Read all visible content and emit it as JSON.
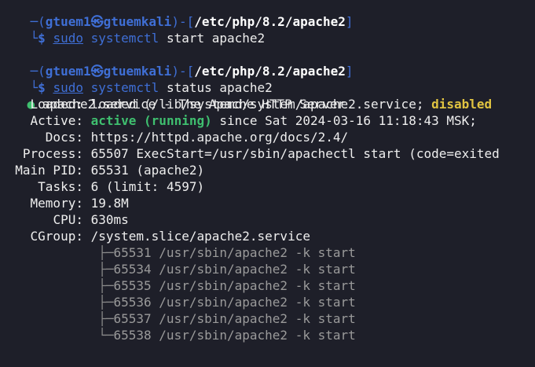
{
  "colors": {
    "background": "#1e1f29",
    "prompt_frame": "#3f6fd6",
    "active_green": "#3fbf6f",
    "disabled_yellow": "#e0c341",
    "faded_text": "#9a9a9a"
  },
  "prompt1": {
    "frame_left": "─(",
    "user": "gtuem1",
    "at_symbol": "㉿",
    "host": "gtuemkali",
    "frame_mid": ")-[",
    "path": "/etc/php/8.2/apache2",
    "frame_right": "]",
    "dollar": "└$",
    "sudo": "sudo",
    "command": "systemctl",
    "args": "start apache2"
  },
  "prompt2": {
    "frame_left": "─(",
    "user": "gtuem1",
    "at_symbol": "㉿",
    "host": "gtuemkali",
    "frame_mid": ")-[",
    "path": "/etc/php/8.2/apache2",
    "frame_right": "]",
    "dollar": "└$",
    "sudo": "sudo",
    "command": "systemctl",
    "args": "status apache2"
  },
  "status": {
    "dot": "●",
    "service_line": "apache2.service - The Apache HTTP Server",
    "loaded_label": "Loaded:",
    "loaded_value": "loaded (/lib/systemd/system/apache2.service; ",
    "loaded_state": "disabled",
    "active_label": "Active:",
    "active_state": "active (running)",
    "active_since": "since Sat 2024-03-16 11:18:43 MSK;",
    "docs_label": "Docs:",
    "docs_value": "https://httpd.apache.org/docs/2.4/",
    "process_label": "Process:",
    "process_value": "65507 ExecStart=/usr/sbin/apachectl start (code=exited",
    "mainpid_label": "Main PID:",
    "mainpid_value": "65531 (apache2)",
    "tasks_label": "Tasks:",
    "tasks_value": "6 (limit: 4597)",
    "memory_label": "Memory:",
    "memory_value": "19.8M",
    "cpu_label": "CPU:",
    "cpu_value": "630ms",
    "cgroup_label": "CGroup:",
    "cgroup_value": "/system.slice/apache2.service",
    "processes": [
      {
        "branch": "├─",
        "text": "65531 /usr/sbin/apache2 -k start"
      },
      {
        "branch": "├─",
        "text": "65534 /usr/sbin/apache2 -k start"
      },
      {
        "branch": "├─",
        "text": "65535 /usr/sbin/apache2 -k start"
      },
      {
        "branch": "├─",
        "text": "65536 /usr/sbin/apache2 -k start"
      },
      {
        "branch": "├─",
        "text": "65537 /usr/sbin/apache2 -k start"
      },
      {
        "branch": "└─",
        "text": "65538 /usr/sbin/apache2 -k start"
      }
    ]
  }
}
